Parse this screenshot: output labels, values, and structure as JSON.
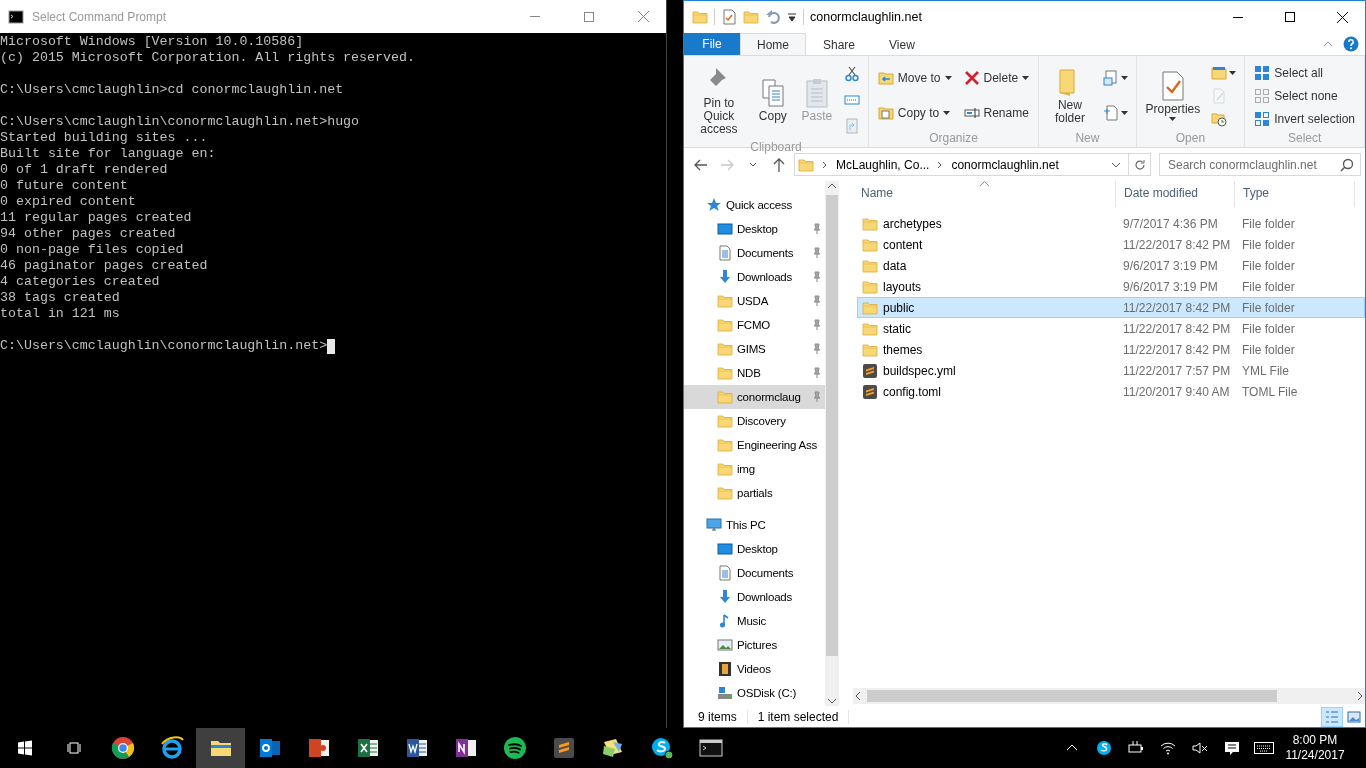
{
  "cmd": {
    "title": "Select Command Prompt",
    "blocks": [
      [
        "Microsoft Windows [Version 10.0.10586]",
        "(c) 2015 Microsoft Corporation. All rights reserved."
      ],
      [
        "C:\\Users\\cmclaughlin>cd conormclaughlin.net"
      ],
      [
        "C:\\Users\\cmclaughlin\\conormclaughlin.net>hugo",
        "Started building sites ...",
        "Built site for language en:",
        "0 of 1 draft rendered",
        "0 future content",
        "0 expired content",
        "11 regular pages created",
        "94 other pages created",
        "0 non-page files copied",
        "46 paginator pages created",
        "4 categories created",
        "38 tags created",
        "total in 121 ms"
      ]
    ],
    "prompt": "C:\\Users\\cmclaughlin\\conormclaughlin.net>"
  },
  "explorer": {
    "title": "conormclaughlin.net",
    "tabs": [
      {
        "label": "File",
        "kind": "file",
        "selected": false
      },
      {
        "label": "Home",
        "kind": "tab",
        "selected": true
      },
      {
        "label": "Share",
        "kind": "tab",
        "selected": false
      },
      {
        "label": "View",
        "kind": "tab",
        "selected": false
      }
    ],
    "ribbon": [
      {
        "label": "Clipboard",
        "columns": [
          [
            {
              "label": "Pin to Quick access",
              "kind": "large",
              "dropdown": false,
              "disabled": false
            }
          ],
          [
            {
              "label": "Copy",
              "kind": "large",
              "dropdown": false,
              "disabled": false
            }
          ],
          [
            {
              "label": "Paste",
              "kind": "large",
              "dropdown": false,
              "disabled": true
            }
          ],
          [
            {
              "kind": "icon",
              "dropdown": false,
              "disabled": false
            },
            {
              "kind": "icon",
              "dropdown": false,
              "disabled": false
            },
            {
              "kind": "icon",
              "dropdown": false,
              "disabled": true
            }
          ]
        ]
      },
      {
        "label": "Organize",
        "columns": [
          [
            {
              "label": "Move to",
              "kind": "small",
              "dropdown": true,
              "disabled": false
            },
            {
              "label": "Copy to",
              "kind": "small",
              "dropdown": true,
              "disabled": false
            }
          ],
          [
            {
              "label": "Delete",
              "kind": "small",
              "dropdown": true,
              "disabled": false
            },
            {
              "label": "Rename",
              "kind": "small",
              "dropdown": false,
              "disabled": false
            }
          ]
        ]
      },
      {
        "label": "New",
        "columns": [
          [
            {
              "label": "New folder",
              "kind": "large",
              "dropdown": false,
              "disabled": false
            }
          ],
          [
            {
              "kind": "icon",
              "dropdown": true,
              "disabled": false
            },
            {
              "kind": "icon",
              "dropdown": true,
              "disabled": false
            }
          ]
        ]
      },
      {
        "label": "Open",
        "columns": [
          [
            {
              "label": "Properties",
              "kind": "large",
              "dropdown": true,
              "disabled": false
            }
          ],
          [
            {
              "kind": "icon",
              "dropdown": true,
              "disabled": false
            },
            {
              "kind": "icon",
              "dropdown": false,
              "disabled": true
            },
            {
              "kind": "icon",
              "dropdown": false,
              "disabled": false
            }
          ]
        ]
      },
      {
        "label": "Select",
        "columns": [
          [
            {
              "label": "Select all",
              "kind": "small",
              "dropdown": false,
              "disabled": false
            },
            {
              "label": "Select none",
              "kind": "small",
              "dropdown": false,
              "disabled": false
            },
            {
              "label": "Invert selection",
              "kind": "small",
              "dropdown": false,
              "disabled": false
            }
          ]
        ]
      }
    ],
    "nav_buttons": [
      {
        "kind": "back",
        "disabled": false
      },
      {
        "kind": "forward",
        "disabled": true
      },
      {
        "kind": "recent",
        "disabled": false
      },
      {
        "kind": "up",
        "disabled": false
      }
    ],
    "breadcrumbs": [
      "McLaughlin, Co...",
      "conormclaughlin.net"
    ],
    "search": {
      "placeholder": "Search conormclaughlin.net"
    },
    "nav": [
      {
        "label": "Quick access",
        "kind": "star",
        "selected": false,
        "children": [
          {
            "label": "Desktop",
            "kind": "desktop",
            "pinned": true,
            "selected": false
          },
          {
            "label": "Documents",
            "kind": "documents",
            "pinned": true,
            "selected": false
          },
          {
            "label": "Downloads",
            "kind": "downloads",
            "pinned": true,
            "selected": false
          },
          {
            "label": "USDA",
            "kind": "folder",
            "pinned": true,
            "selected": false
          },
          {
            "label": "FCMO",
            "kind": "folder",
            "pinned": true,
            "selected": false
          },
          {
            "label": "GIMS",
            "kind": "folder",
            "pinned": true,
            "selected": false
          },
          {
            "label": "NDB",
            "kind": "folder",
            "pinned": true,
            "selected": false
          },
          {
            "label": "conormclaug",
            "kind": "folder",
            "pinned": true,
            "selected": true
          },
          {
            "label": "Discovery",
            "kind": "folder",
            "pinned": false,
            "selected": false
          },
          {
            "label": "Engineering Ass",
            "kind": "folder",
            "pinned": false,
            "selected": false
          },
          {
            "label": "img",
            "kind": "folder",
            "pinned": false,
            "selected": false
          },
          {
            "label": "partials",
            "kind": "folder",
            "pinned": false,
            "selected": false
          }
        ]
      },
      {
        "label": "This PC",
        "kind": "pc",
        "selected": false,
        "children": [
          {
            "label": "Desktop",
            "kind": "desktop",
            "pinned": false,
            "selected": false
          },
          {
            "label": "Documents",
            "kind": "documents",
            "pinned": false,
            "selected": false
          },
          {
            "label": "Downloads",
            "kind": "downloads",
            "pinned": false,
            "selected": false
          },
          {
            "label": "Music",
            "kind": "music",
            "pinned": false,
            "selected": false
          },
          {
            "label": "Pictures",
            "kind": "pictures",
            "pinned": false,
            "selected": false
          },
          {
            "label": "Videos",
            "kind": "videos",
            "pinned": false,
            "selected": false
          },
          {
            "label": "OSDisk (C:)",
            "kind": "disk",
            "pinned": false,
            "selected": false
          }
        ]
      }
    ],
    "columns": [
      "Name",
      "Date modified",
      "Type"
    ],
    "rows": [
      {
        "name": "archetypes",
        "date": "9/7/2017 4:36 PM",
        "type": "File folder",
        "kind": "folder",
        "selected": false
      },
      {
        "name": "content",
        "date": "11/22/2017 8:42 PM",
        "type": "File folder",
        "kind": "folder",
        "selected": false
      },
      {
        "name": "data",
        "date": "9/6/2017 3:19 PM",
        "type": "File folder",
        "kind": "folder",
        "selected": false
      },
      {
        "name": "layouts",
        "date": "9/6/2017 3:19 PM",
        "type": "File folder",
        "kind": "folder",
        "selected": false
      },
      {
        "name": "public",
        "date": "11/22/2017 8:42 PM",
        "type": "File folder",
        "kind": "folder",
        "selected": true
      },
      {
        "name": "static",
        "date": "11/22/2017 8:42 PM",
        "type": "File folder",
        "kind": "folder",
        "selected": false
      },
      {
        "name": "themes",
        "date": "11/22/2017 8:42 PM",
        "type": "File folder",
        "kind": "folder",
        "selected": false
      },
      {
        "name": "buildspec.yml",
        "date": "11/22/2017 7:57 PM",
        "type": "YML File",
        "kind": "editor",
        "selected": false
      },
      {
        "name": "config.toml",
        "date": "11/20/2017 9:40 AM",
        "type": "TOML File",
        "kind": "editor",
        "selected": false
      }
    ],
    "status": {
      "count": "9 items",
      "selection": "1 item selected"
    },
    "views": [
      {
        "kind": "details",
        "selected": true
      },
      {
        "kind": "thumbnails",
        "selected": false
      }
    ]
  },
  "taskbar": {
    "apps": [
      {
        "kind": "browser",
        "selected": false
      },
      {
        "kind": "globe",
        "selected": false
      },
      {
        "kind": "folder",
        "selected": true
      },
      {
        "kind": "mail",
        "selected": false
      },
      {
        "kind": "slides",
        "selected": false
      },
      {
        "kind": "sheet",
        "selected": false
      },
      {
        "kind": "doc",
        "selected": false
      },
      {
        "kind": "notebook",
        "selected": false
      },
      {
        "kind": "music",
        "selected": false
      },
      {
        "kind": "editor",
        "selected": false
      },
      {
        "kind": "photos",
        "selected": false
      },
      {
        "kind": "chat",
        "selected": false
      },
      {
        "kind": "terminal",
        "selected": false
      }
    ],
    "time": "8:00 PM",
    "date": "11/24/2017"
  }
}
